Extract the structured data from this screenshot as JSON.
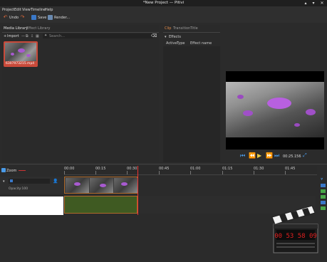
{
  "window": {
    "title": "*New Project — Pitivi",
    "controls": [
      "▴",
      "▾",
      "✕"
    ]
  },
  "menu": {
    "items": [
      "Project",
      "Edit",
      "View",
      "Timeline",
      "Help"
    ]
  },
  "toolbar": {
    "undo": "Undo",
    "save": "Save",
    "render": "Render..."
  },
  "library": {
    "tabs": [
      "Media Library",
      "Effect Library"
    ],
    "import_label": "Import",
    "search_placeholder": "Search...",
    "clip_name": "6307973215.mp4"
  },
  "clip_panel": {
    "tabs": [
      "Clip",
      "Transition",
      "Title"
    ],
    "effects_label": "Effects",
    "columns": [
      "Active",
      "Type",
      "Effect name"
    ]
  },
  "viewer": {
    "time": "00:25.156"
  },
  "timeline": {
    "zoom_label": "Zoom",
    "ticks": [
      "00:00",
      "00:15",
      "00:30",
      "00:45",
      "01:00",
      "01:15",
      "01:30",
      "01:45"
    ],
    "opacity_label": "Opacity:100"
  },
  "colors": {
    "accent": "#4a9be8",
    "clip_border": "#b06a2a",
    "playhead": "#e33333",
    "thumb_selected": "#c94a3a"
  }
}
